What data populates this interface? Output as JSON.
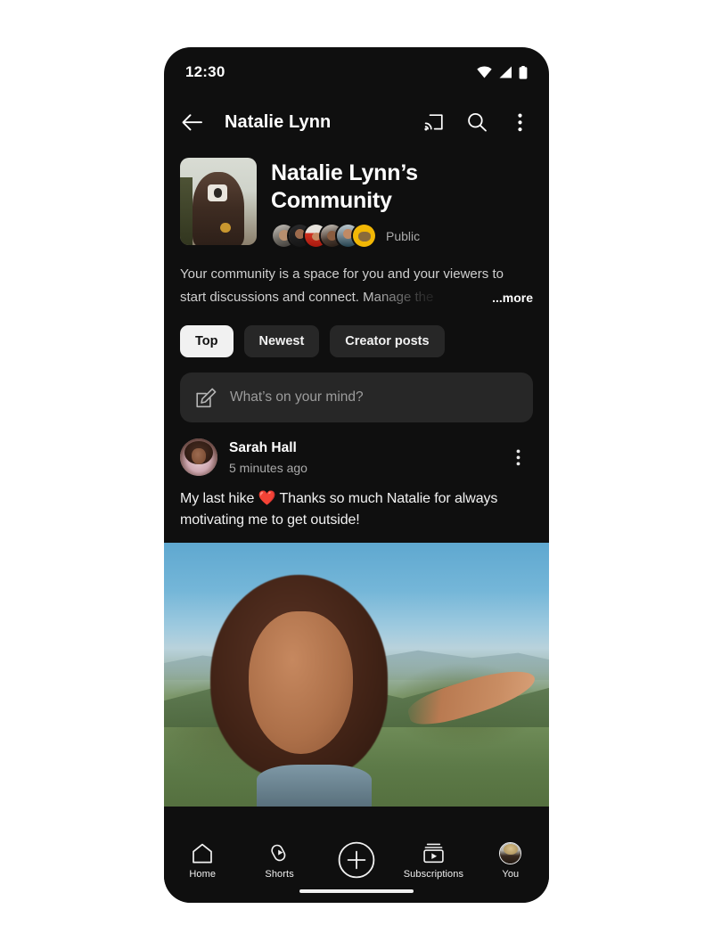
{
  "status_bar": {
    "time": "12:30",
    "icons": [
      "wifi-icon",
      "cellular-signal-icon",
      "battery-icon"
    ]
  },
  "app_bar": {
    "back_label": "back-arrow-icon",
    "title": "Natalie Lynn",
    "actions": [
      {
        "name": "cast-icon",
        "label": "Cast"
      },
      {
        "name": "search-icon",
        "label": "Search"
      },
      {
        "name": "overflow-menu-icon",
        "label": "More options"
      }
    ]
  },
  "community": {
    "thumbnail_alt": "community-thumbnail",
    "title": "Natalie Lynn’s Community",
    "privacy": "Public",
    "member_avatar_count": 6,
    "description": "Your community is a space for you and your viewers to start discussions and connect. Manage the",
    "more_label": "...more"
  },
  "filters": {
    "chips": [
      {
        "label": "Top",
        "selected": true
      },
      {
        "label": "Newest",
        "selected": false
      },
      {
        "label": "Creator posts",
        "selected": false
      }
    ]
  },
  "composer": {
    "icon": "compose-pencil-icon",
    "placeholder": "What’s on your mind?",
    "value": ""
  },
  "post": {
    "author": "Sarah Hall",
    "timestamp": "5 minutes ago",
    "overflow_icon": "overflow-menu-icon",
    "text_before_emoji": "My last hike ",
    "emoji": "❤️",
    "text_after_emoji": " Thanks so much Natalie for always motivating me to get outside!",
    "media_alt": "post-photo-hiker-on-mountain"
  },
  "bottom_nav": {
    "items": [
      {
        "label": "Home",
        "icon": "home-icon"
      },
      {
        "label": "Shorts",
        "icon": "shorts-icon"
      },
      {
        "label": "",
        "icon": "create-plus-icon"
      },
      {
        "label": "Subscriptions",
        "icon": "subscriptions-icon"
      },
      {
        "label": "You",
        "icon": "account-avatar-icon"
      }
    ]
  },
  "colors": {
    "page_background": "#ffffff",
    "app_background": "#0f0f0f",
    "surface": "#272727",
    "text_primary": "#f1f1f1",
    "text_secondary": "#aaaaaa",
    "chip_active_bg": "#f1f1f1",
    "chip_active_text": "#0f0f0f",
    "heart_red": "#e8342a"
  }
}
